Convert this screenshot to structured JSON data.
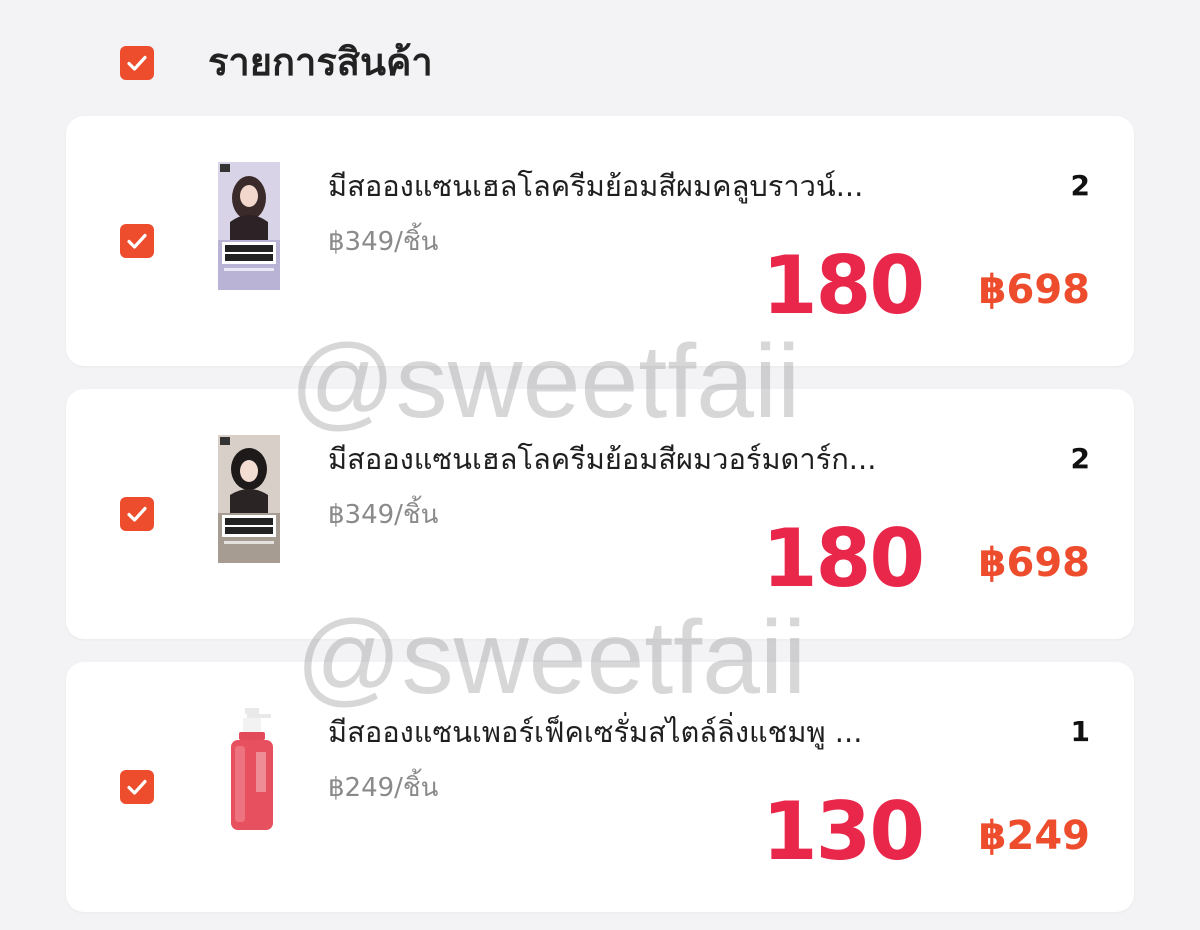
{
  "header": {
    "title": "รายการสินค้า",
    "select_all_checked": true
  },
  "colors": {
    "accent": "#ee4d2d",
    "overlay_price": "#e8274a",
    "card_bg": "#ffffff",
    "page_bg": "#f3f3f5"
  },
  "items": [
    {
      "name": "มีสอองแซนเฮลโลครีมย้อมสีผมคลูบราวน์...",
      "unit_price": "฿349/ชิ้น",
      "quantity": "2",
      "total": "฿698",
      "overlay_price": "180",
      "checked": true,
      "thumb_icon": "hair-dye-box-icon"
    },
    {
      "name": "มีสอองแซนเฮลโลครีมย้อมสีผมวอร์มดาร์ก...",
      "unit_price": "฿349/ชิ้น",
      "quantity": "2",
      "total": "฿698",
      "overlay_price": "180",
      "checked": true,
      "thumb_icon": "hair-dye-box-icon"
    },
    {
      "name": "มีสอองแซนเพอร์เฟ็คเซรั่มสไตล์ลิ่งแชมพู ...",
      "unit_price": "฿249/ชิ้น",
      "quantity": "1",
      "total": "฿249",
      "overlay_price": "130",
      "checked": true,
      "thumb_icon": "shampoo-bottle-icon"
    }
  ],
  "watermark": "@sweetfaii"
}
